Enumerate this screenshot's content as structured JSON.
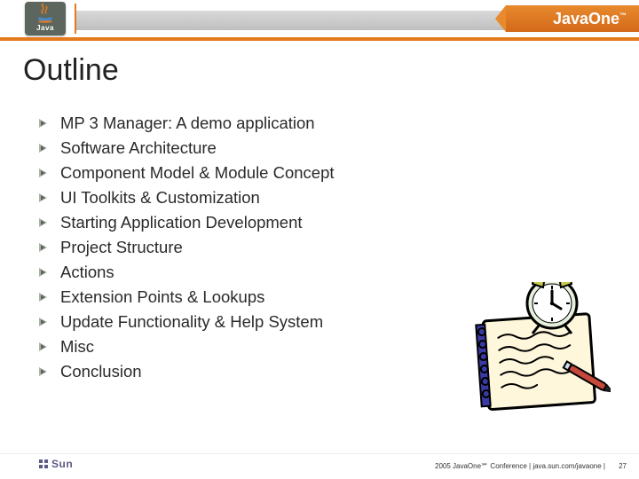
{
  "header": {
    "badge_label": "Java",
    "brand": "JavaOne",
    "brand_tm": "™"
  },
  "title": "Outline",
  "outline": [
    "MP 3 Manager: A demo application",
    "Software Architecture",
    "Component Model & Module Concept",
    "UI Toolkits & Customization",
    "Starting Application Development",
    "Project Structure",
    "Actions",
    "Extension Points & Lookups",
    "Update Functionality & Help System",
    "Misc",
    "Conclusion"
  ],
  "footer": {
    "sun": "Sun",
    "conference_line": "2005 JavaOne℠ Conference  |  java.sun.com/javaone  |",
    "page_number": "27"
  }
}
